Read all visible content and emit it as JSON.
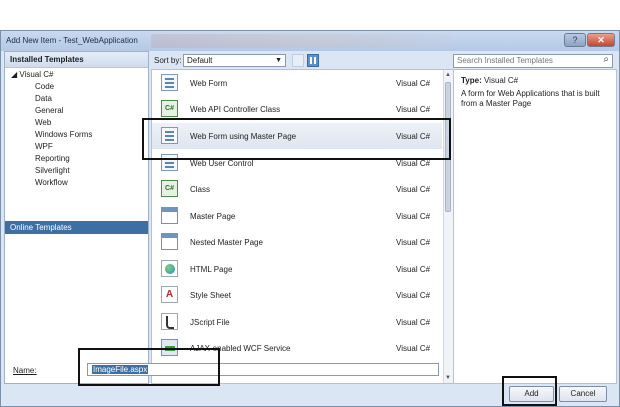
{
  "window": {
    "title": "Add New Item - Test_WebApplication"
  },
  "sidebar": {
    "header": "Installed Templates",
    "tree": [
      {
        "label": "◢ Visual C#",
        "level": 0
      },
      {
        "label": "Code",
        "level": 1
      },
      {
        "label": "Data",
        "level": 1
      },
      {
        "label": "General",
        "level": 1
      },
      {
        "label": "Web",
        "level": 1
      },
      {
        "label": "Windows Forms",
        "level": 1
      },
      {
        "label": "WPF",
        "level": 1
      },
      {
        "label": "Reporting",
        "level": 1
      },
      {
        "label": "Silverlight",
        "level": 1
      },
      {
        "label": "Workflow",
        "level": 1
      }
    ],
    "online": "Online Templates"
  },
  "toolbar": {
    "sort_label": "Sort by:",
    "sort_value": "Default"
  },
  "search": {
    "placeholder": "Search Installed Templates"
  },
  "templates": [
    {
      "name": "Web Form",
      "lang": "Visual C#",
      "icon": "web-form-icon"
    },
    {
      "name": "Web API Controller Class",
      "lang": "Visual C#",
      "icon": "csharp-class-icon"
    },
    {
      "name": "Web Form using Master Page",
      "lang": "Visual C#",
      "icon": "web-form-master-icon",
      "selected": true
    },
    {
      "name": "Web User Control",
      "lang": "Visual C#",
      "icon": "user-control-icon"
    },
    {
      "name": "Class",
      "lang": "Visual C#",
      "icon": "csharp-class-icon"
    },
    {
      "name": "Master Page",
      "lang": "Visual C#",
      "icon": "master-page-icon"
    },
    {
      "name": "Nested Master Page",
      "lang": "Visual C#",
      "icon": "nested-master-page-icon"
    },
    {
      "name": "HTML Page",
      "lang": "Visual C#",
      "icon": "html-page-icon"
    },
    {
      "name": "Style Sheet",
      "lang": "Visual C#",
      "icon": "style-sheet-icon"
    },
    {
      "name": "JScript File",
      "lang": "Visual C#",
      "icon": "jscript-file-icon"
    },
    {
      "name": "AJAX-enabled WCF Service",
      "lang": "Visual C#",
      "icon": "wcf-service-icon"
    }
  ],
  "details": {
    "type_label": "Type:",
    "type_value": "Visual C#",
    "description": "A form for Web Applications that is built from a Master Page"
  },
  "footer": {
    "name_label": "Name:",
    "name_value": "ImageFile.aspx",
    "add_label": "Add",
    "cancel_label": "Cancel"
  }
}
